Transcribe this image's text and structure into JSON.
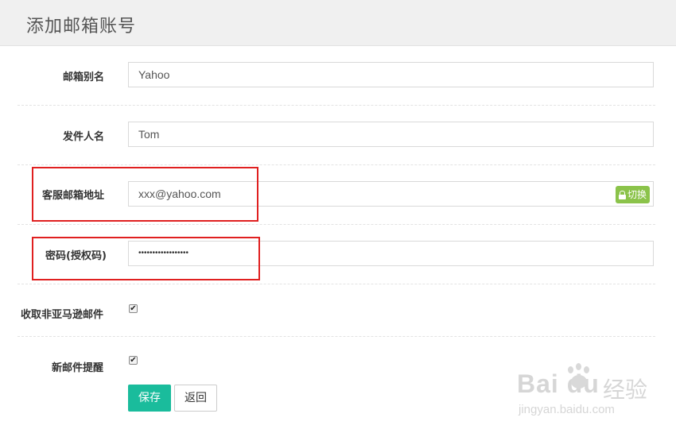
{
  "header": {
    "title": "添加邮箱账号"
  },
  "form": {
    "alias": {
      "label": "邮箱别名",
      "value": "Yahoo"
    },
    "sender": {
      "label": "发件人名",
      "value": "Tom"
    },
    "service_email": {
      "label": "客服邮箱地址",
      "value": "xxx@yahoo.com",
      "switch_label": "切换"
    },
    "password": {
      "label": "密码(授权码)",
      "value": "••••••••••••••••••"
    },
    "receive_non_amazon": {
      "label": "收取非亚马逊邮件",
      "checked": true
    },
    "new_mail_alert": {
      "label": "新邮件提醒",
      "checked": true
    }
  },
  "actions": {
    "save_label": "保存",
    "back_label": "返回"
  },
  "watermark": {
    "logo": "Bai du",
    "brand": "经验",
    "url": "jingyan.baidu.com"
  },
  "colors": {
    "save_button": "#1abc9c",
    "switch_button": "#8bc34a",
    "highlight": "#e02020"
  }
}
